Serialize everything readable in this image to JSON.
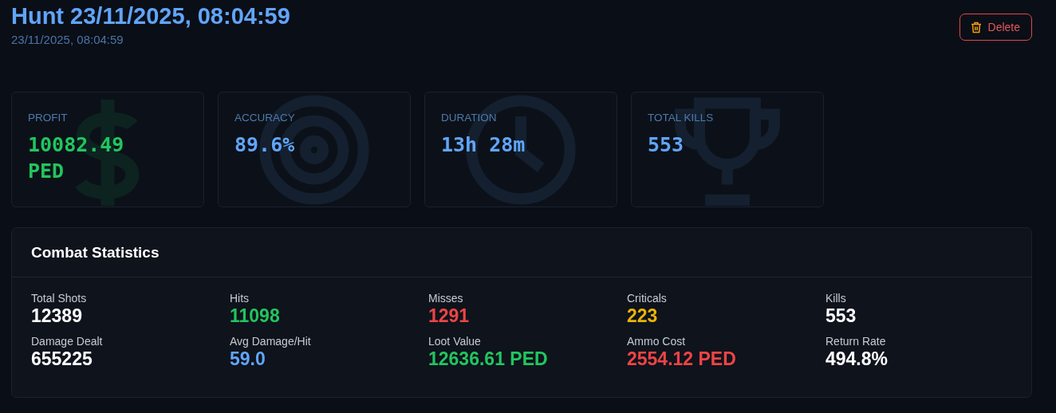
{
  "header": {
    "title": "Hunt 23/11/2025, 08:04:59",
    "subtitle": "23/11/2025, 08:04:59",
    "delete_button": "Delete"
  },
  "summary_cards": [
    {
      "kind": "profit",
      "label": "PROFIT",
      "value": "10082.49 PED",
      "color": "#22c55e"
    },
    {
      "kind": "accuracy",
      "label": "ACCURACY",
      "value": "89.6%",
      "color": "#60a5fa"
    },
    {
      "kind": "duration",
      "label": "DURATION",
      "value": "13h 28m",
      "color": "#60a5fa"
    },
    {
      "kind": "kills",
      "label": "TOTAL KILLS",
      "value": "553",
      "color": "#60a5fa"
    }
  ],
  "combat_statistics": {
    "title": "Combat Statistics",
    "stats": [
      {
        "label": "Total Shots",
        "value": "12389",
        "color": "#ffffff"
      },
      {
        "label": "Hits",
        "value": "11098",
        "color": "#22c55e"
      },
      {
        "label": "Misses",
        "value": "1291",
        "color": "#ef4444"
      },
      {
        "label": "Criticals",
        "value": "223",
        "color": "#eab308"
      },
      {
        "label": "Kills",
        "value": "553",
        "color": "#ffffff"
      },
      {
        "label": "Damage Dealt",
        "value": "655225",
        "color": "#ffffff"
      },
      {
        "label": "Avg Damage/Hit",
        "value": "59.0",
        "color": "#60a5fa"
      },
      {
        "label": "Loot Value",
        "value": "12636.61 PED",
        "color": "#22c55e"
      },
      {
        "label": "Ammo Cost",
        "value": "2554.12 PED",
        "color": "#ef4444"
      },
      {
        "label": "Return Rate",
        "value": "494.8%",
        "color": "#ffffff"
      }
    ]
  }
}
